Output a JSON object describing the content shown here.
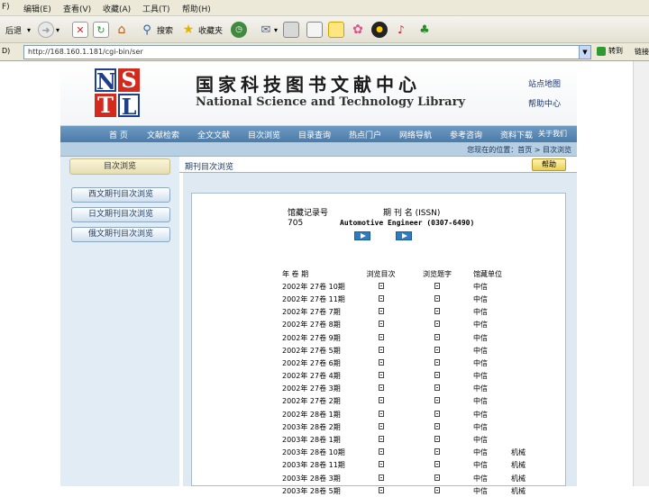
{
  "browser": {
    "menu": [
      "F)",
      "编辑(E)",
      "查看(V)",
      "收藏(A)",
      "工具(T)",
      "帮助(H)"
    ],
    "toolbar": {
      "back_label": "后退",
      "search_label": "搜索",
      "favorites_label": "收藏夹"
    },
    "address": {
      "label": "D)",
      "url": "http://168.160.1.181/cgi-bin/ser",
      "go_label": "转到",
      "links_label": "链接"
    }
  },
  "site": {
    "logo_letters": [
      "N",
      "S",
      "T",
      "L"
    ],
    "title_cn": "国家科技图书文献中心",
    "title_en": "National Science and Technology Library",
    "link_map": "站点地图",
    "link_help": "帮助中心",
    "nav": [
      "首 页",
      "文献检索",
      "全文文献",
      "目次浏览",
      "目录查询",
      "热点门户",
      "网络导航",
      "参考咨询",
      "资料下载",
      "关于我们"
    ],
    "crumb": "您现在的位置：首页 > 目次浏览"
  },
  "sidebar": {
    "title": "目次浏览",
    "items": [
      "西文期刊目次浏览",
      "日文期刊目次浏览",
      "俄文期刊目次浏览"
    ]
  },
  "main": {
    "section_title": "期刊目次浏览",
    "help_label": "帮助",
    "record_label": "馆藏记录号",
    "record_value": "705",
    "journal_label": "期 刊 名 (ISSN)",
    "journal_value": "Automotive Engineer (0307-6490)",
    "columns": [
      "年  卷  期",
      "浏览目次",
      "浏览题字",
      "馆藏单位"
    ],
    "rows": [
      {
        "issue": "2002年 27卷 10期",
        "unit": "中信",
        "subject": ""
      },
      {
        "issue": "2002年 27卷 11期",
        "unit": "中信",
        "subject": ""
      },
      {
        "issue": "2002年 27卷 7期",
        "unit": "中信",
        "subject": ""
      },
      {
        "issue": "2002年 27卷 8期",
        "unit": "中信",
        "subject": ""
      },
      {
        "issue": "2002年 27卷 9期",
        "unit": "中信",
        "subject": ""
      },
      {
        "issue": "2002年 27卷 5期",
        "unit": "中信",
        "subject": ""
      },
      {
        "issue": "2002年 27卷 6期",
        "unit": "中信",
        "subject": ""
      },
      {
        "issue": "2002年 27卷 4期",
        "unit": "中信",
        "subject": ""
      },
      {
        "issue": "2002年 27卷 3期",
        "unit": "中信",
        "subject": ""
      },
      {
        "issue": "2002年 27卷 2期",
        "unit": "中信",
        "subject": ""
      },
      {
        "issue": "2002年 28卷 1期",
        "unit": "中信",
        "subject": ""
      },
      {
        "issue": "2003年 28卷 2期",
        "unit": "中信",
        "subject": ""
      },
      {
        "issue": "2003年 28卷 1期",
        "unit": "中信",
        "subject": ""
      },
      {
        "issue": "2003年 28卷 10期",
        "unit": "中信",
        "subject": "机械"
      },
      {
        "issue": "2003年 28卷 11期",
        "unit": "中信",
        "subject": "机械"
      },
      {
        "issue": "2003年 28卷 3期",
        "unit": "中信",
        "subject": "机械"
      },
      {
        "issue": "2003年 28卷 5期",
        "unit": "中信",
        "subject": "机械"
      }
    ]
  }
}
